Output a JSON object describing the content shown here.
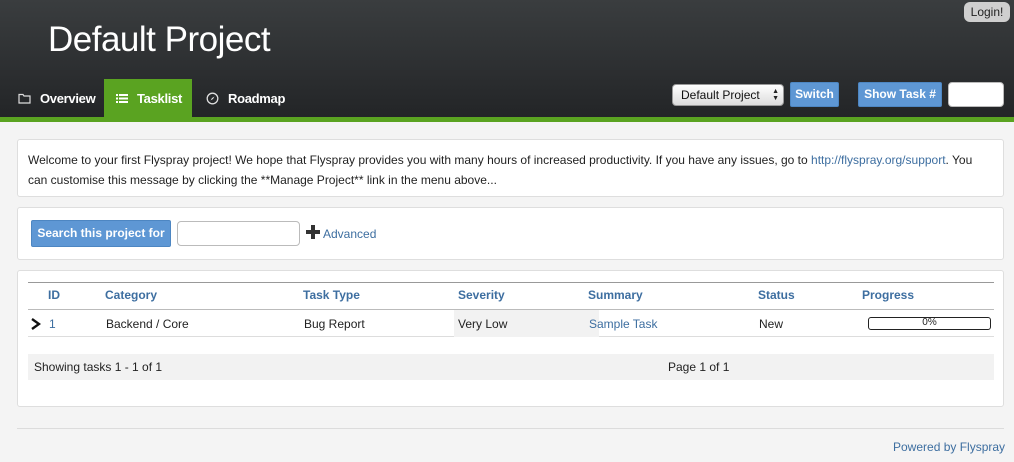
{
  "header": {
    "login_label": "Login!",
    "project_title": "Default Project",
    "accent_color": "#5aa321",
    "tabs": [
      {
        "label": "Overview",
        "icon": "folder-icon"
      },
      {
        "label": "Tasklist",
        "icon": "list-icon",
        "active": true
      },
      {
        "label": "Roadmap",
        "icon": "compass-icon"
      }
    ],
    "project_select": {
      "selected": "Default Project"
    },
    "switch_label": "Switch",
    "show_task_label": "Show Task #"
  },
  "welcome": {
    "text_before": "Welcome to your first Flyspray project! We hope that Flyspray provides you with many hours of increased productivity. If you have any issues, go to ",
    "link_text": "http://flyspray.org/support",
    "text_after": ". You can customise this message by clicking the **Manage Project** link in the menu above..."
  },
  "search": {
    "button_label": "Search this project for",
    "advanced_label": "Advanced",
    "input_value": ""
  },
  "table": {
    "columns": [
      "ID",
      "Category",
      "Task Type",
      "Severity",
      "Summary",
      "Status",
      "Progress"
    ],
    "rows": [
      {
        "id": "1",
        "category": "Backend / Core",
        "task_type": "Bug Report",
        "severity": "Very Low",
        "summary": "Sample Task",
        "status": "New",
        "progress": "0%"
      }
    ],
    "showing": "Showing tasks 1 - 1 of 1",
    "page": "Page 1 of 1"
  },
  "footer": {
    "powered_by": "Powered by Flyspray"
  }
}
